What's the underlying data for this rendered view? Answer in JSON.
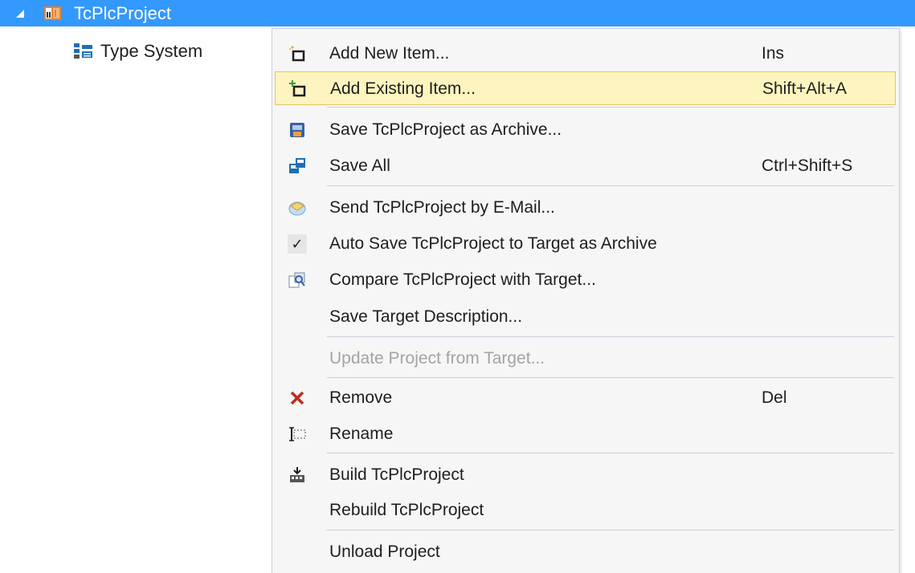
{
  "tree": {
    "project": {
      "label": "TcPlcProject",
      "icon": "plc-project-icon"
    },
    "children": [
      {
        "label": "Type System",
        "icon": "type-system-icon"
      }
    ]
  },
  "context_menu": {
    "items": [
      {
        "label": "Add New Item...",
        "shortcut": "Ins",
        "icon": "add-new-item-icon"
      },
      {
        "label": "Add Existing Item...",
        "shortcut": "Shift+Alt+A",
        "icon": "add-existing-item-icon",
        "state": "hover"
      },
      {
        "label": "Save TcPlcProject as Archive...",
        "shortcut": "",
        "icon": "save-archive-icon"
      },
      {
        "label": "Save All",
        "shortcut": "Ctrl+Shift+S",
        "icon": "save-all-icon"
      },
      {
        "label": "Send TcPlcProject by E-Mail...",
        "shortcut": "",
        "icon": "email-icon"
      },
      {
        "label": "Auto Save TcPlcProject to Target as Archive",
        "shortcut": "",
        "icon": "checkmark-icon",
        "checked": true
      },
      {
        "label": "Compare TcPlcProject with Target...",
        "shortcut": "",
        "icon": "compare-icon"
      },
      {
        "label": "Save Target Description...",
        "shortcut": "",
        "icon": ""
      },
      {
        "label": "Update Project from Target...",
        "shortcut": "",
        "icon": "",
        "disabled": true
      },
      {
        "label": "Remove",
        "shortcut": "Del",
        "icon": "remove-x-icon"
      },
      {
        "label": "Rename",
        "shortcut": "",
        "icon": "rename-icon"
      },
      {
        "label": "Build TcPlcProject",
        "shortcut": "",
        "icon": "build-icon"
      },
      {
        "label": "Rebuild TcPlcProject",
        "shortcut": "",
        "icon": ""
      },
      {
        "label": "Unload Project",
        "shortcut": "",
        "icon": ""
      }
    ]
  },
  "colors": {
    "selection": "#3399ff",
    "menu_background": "#f6f6f6",
    "hover_background": "#fdf4bf",
    "hover_border": "#e5c365",
    "separator": "#cccedb",
    "disabled_text": "#a2a4a5",
    "remove_red": "#c42b1c"
  }
}
